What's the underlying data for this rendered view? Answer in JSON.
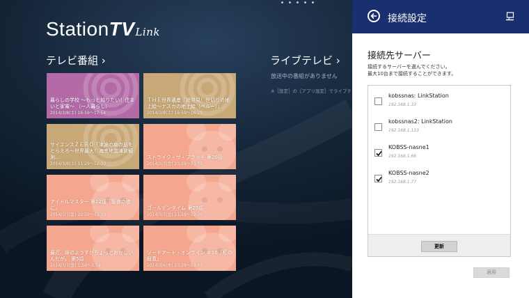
{
  "app": {
    "logo": {
      "station": "Station",
      "tv": "TV",
      "link": "Link"
    },
    "tv_programs": {
      "title": "テレビ番組 ›",
      "tiles": [
        {
          "title": "暮らしの学校 ～もっと知りたい！住まいと家電～ （一人暮らし）",
          "date": "2014/3/8(土) 16:59～17:54",
          "bg": "#b36aa7",
          "art": "tv"
        },
        {
          "title": "ＴＨＥ世界遺産「総発見！世切りの地上絵～ナスカの地上絵（ペルー）」",
          "date": "2014/3/8(土) 16:59～16:29",
          "bg": "#c9a877",
          "art": "tv"
        },
        {
          "title": "サイエンスＺＥＲＯ「津波の痕の迫をとらえろ～世界最大！海底地震津波観測…",
          "date": "2014/3/8(土) 11:29～12:00",
          "bg": "#c9a877",
          "art": "tv"
        },
        {
          "title": "ストライク・ザ・ブラッド 第20話",
          "date": "2014/3/7(金) 23:29～23:59",
          "bg": "#f4a78e",
          "art": "anime"
        },
        {
          "title": "アイドルマスター 第22話「聖夜の夜に」",
          "date": "2014/3/7(金) 22:59～23:30",
          "bg": "#f4a78e",
          "art": "anime"
        },
        {
          "title": "ゴールデンタイム 第20話",
          "date": "2014/3/7(金) 21:59～22:30",
          "bg": "#f4a78e",
          "art": "anime"
        },
        {
          "title": "最近、妹のようすがちょっとおかしいんだが。 第5話",
          "date": "2014/3/7(金) 1:59～2:29",
          "bg": "#f4a78e",
          "art": "anime"
        },
        {
          "title": "ソードアート・オンライン ＃10「紅の殺意」",
          "date": "2014/3/6(木) 23:29～23:59",
          "bg": "#f4a78e",
          "art": "anime"
        }
      ]
    },
    "live_tv": {
      "title": "ライブテレビ ›",
      "message": "放送中の番組がありません",
      "hint": "※［設定］の［アプリ設定］でライブテレビ"
    }
  },
  "settings": {
    "header_title": "接続設定",
    "section_title": "接続先サーバー",
    "desc_line1": "接続するサーバーを選んでください。",
    "desc_line2": "最大10台まで接続することができます。",
    "servers": [
      {
        "name": "kobssnas: LinkStation",
        "ip": "192.168.1.33",
        "checked": false
      },
      {
        "name": "kobssnas2: LinkStation",
        "ip": "192.168.1.133",
        "checked": false
      },
      {
        "name": "KOBSS-nasne1",
        "ip": "192.168.1.66",
        "checked": true
      },
      {
        "name": "KOBSS-nasne2",
        "ip": "192.168.1.77",
        "checked": true
      }
    ],
    "refresh_label": "更新",
    "apply_label": "適用"
  },
  "colors": {
    "header_bg": "#1a2f6e",
    "tile_purple": "#b36aa7",
    "tile_tan": "#c9a877",
    "tile_salmon": "#f4a78e"
  }
}
